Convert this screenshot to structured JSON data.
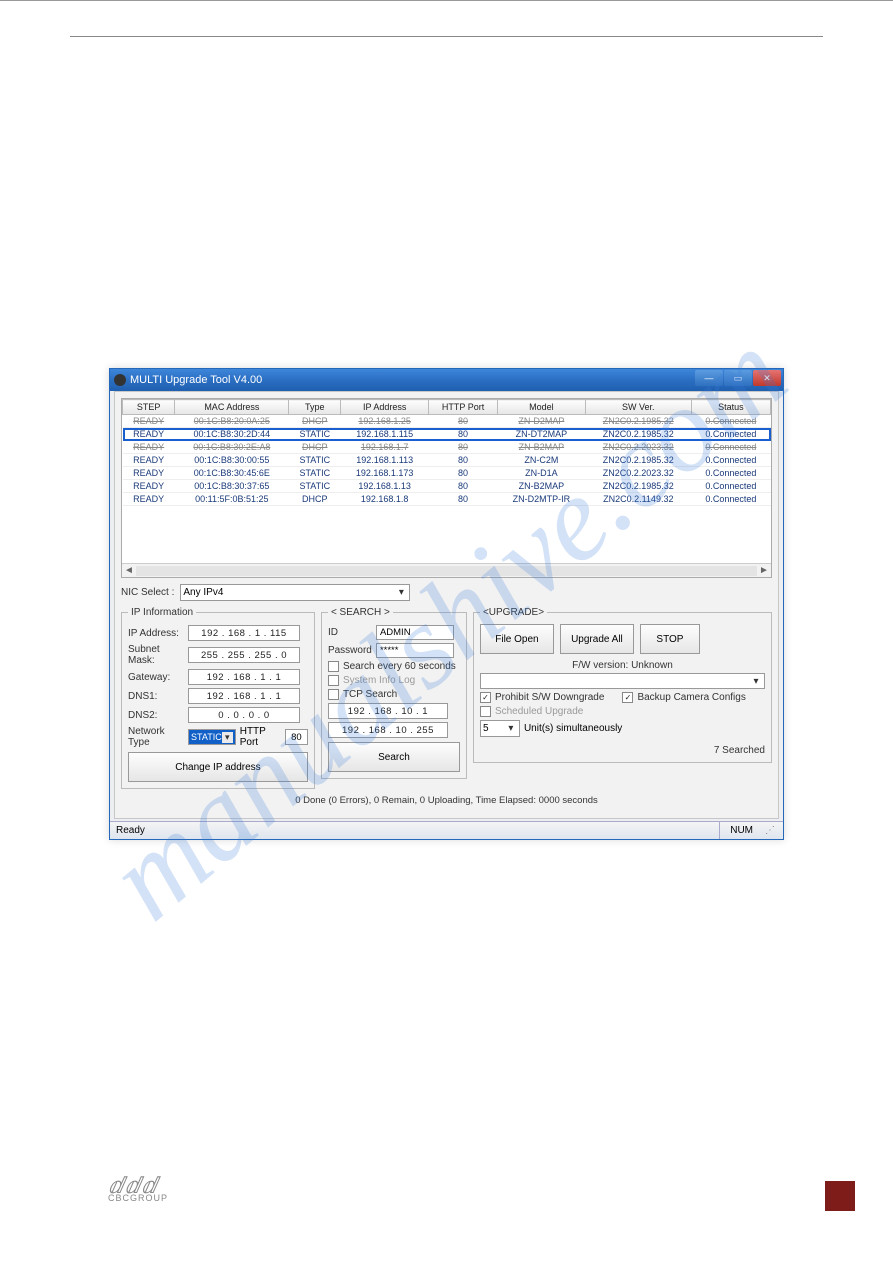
{
  "window": {
    "title": "MULTI Upgrade Tool V4.00",
    "min": "—",
    "max": "▭",
    "close": "✕"
  },
  "table": {
    "headers": [
      "STEP",
      "MAC Address",
      "Type",
      "IP Address",
      "HTTP Port",
      "Model",
      "SW Ver.",
      "Status"
    ],
    "rows": [
      {
        "step": "READY",
        "mac": "00:1C:B8:20:0A:25",
        "type": "DHCP",
        "ip": "192.168.1.25",
        "port": "80",
        "model": "ZN-D2MAP",
        "ver": "ZN2C0.2.1985.32",
        "status": "0.Connected",
        "struck": true
      },
      {
        "step": "READY",
        "mac": "00:1C:B8:30:2D:44",
        "type": "STATIC",
        "ip": "192.168.1.115",
        "port": "80",
        "model": "ZN-DT2MAP",
        "ver": "ZN2C0.2.1985.32",
        "status": "0.Connected",
        "selected": true
      },
      {
        "step": "READY",
        "mac": "00:1C:B8:30:2E:A8",
        "type": "DHCP",
        "ip": "192.168.1.7",
        "port": "80",
        "model": "ZN-B2MAP",
        "ver": "ZN2C0.2.2023.32",
        "status": "0.Connected",
        "struck": true
      },
      {
        "step": "READY",
        "mac": "00:1C:B8:30:00:55",
        "type": "STATIC",
        "ip": "192.168.1.113",
        "port": "80",
        "model": "ZN-C2M",
        "ver": "ZN2C0.2.1985.32",
        "status": "0.Connected"
      },
      {
        "step": "READY",
        "mac": "00:1C:B8:30:45:6E",
        "type": "STATIC",
        "ip": "192.168.1.173",
        "port": "80",
        "model": "ZN-D1A",
        "ver": "ZN2C0.2.2023.32",
        "status": "0.Connected"
      },
      {
        "step": "READY",
        "mac": "00:1C:B8:30:37:65",
        "type": "STATIC",
        "ip": "192.168.1.13",
        "port": "80",
        "model": "ZN-B2MAP",
        "ver": "ZN2C0.2.1985.32",
        "status": "0.Connected"
      },
      {
        "step": "READY",
        "mac": "00:11:5F:0B:51:25",
        "type": "DHCP",
        "ip": "192.168.1.8",
        "port": "80",
        "model": "ZN-D2MTP-IR",
        "ver": "ZN2C0.2.1149.32",
        "status": "0.Connected"
      }
    ],
    "scroll_left": "◄",
    "scroll_right": "►"
  },
  "nic": {
    "label": "NIC Select :",
    "value": "Any IPv4"
  },
  "ip_info": {
    "legend": "IP Information",
    "ip_label": "IP Address:",
    "ip": "192 . 168 .  1  . 115",
    "mask_label": "Subnet Mask:",
    "mask": "255 . 255 . 255 .  0",
    "gw_label": "Gateway:",
    "gw": "192 . 168 .  1  .  1",
    "dns1_label": "DNS1:",
    "dns1": "192 . 168 .  1  .  1",
    "dns2_label": "DNS2:",
    "dns2": "0  .  0  .  0  .  0",
    "nt_label": "Network Type",
    "nt": "STATIC",
    "port_label": "HTTP Port",
    "port": "80",
    "change_btn": "Change IP address"
  },
  "search": {
    "legend": "< SEARCH >",
    "id_label": "ID",
    "id": "ADMIN",
    "pw_label": "Password",
    "pw": "*****",
    "every60": "Search every 60 seconds",
    "syslog": "System Info Log",
    "tcp": "TCP Search",
    "tcp_from": "192 . 168 .  10  .  1",
    "tcp_to": "192 . 168 .  10  . 255",
    "btn": "Search"
  },
  "upgrade": {
    "legend": "<UPGRADE>",
    "file_open": "File Open",
    "upgrade_all": "Upgrade All",
    "stop": "STOP",
    "fw_label": "F/W version: Unknown",
    "prohibit": "Prohibit S/W Downgrade",
    "backup": "Backup Camera Configs",
    "scheduled": "Scheduled Upgrade",
    "sim_value": "5",
    "sim_label": "Unit(s) simultaneously",
    "searched": "7 Searched",
    "progress": "0 Done (0 Errors), 0 Remain, 0 Uploading, Time Elapsed: 0000 seconds"
  },
  "statusbar": {
    "ready": "Ready",
    "num": "NUM",
    "grip": "⋰"
  },
  "watermark": "manualshive.com",
  "footer": {
    "brand": "CBCGROUP"
  }
}
